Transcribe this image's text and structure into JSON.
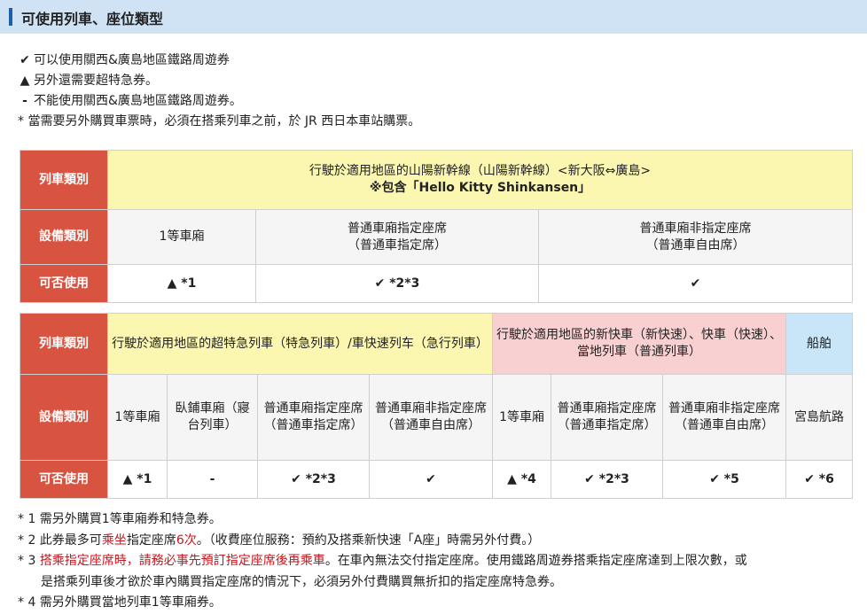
{
  "title": "可使用列車、座位類型",
  "legend": [
    {
      "symbol": "✔",
      "text": "可以使用關西&廣島地區鐵路周遊券"
    },
    {
      "symbol": "▲",
      "text": "另外還需要超特急券。"
    },
    {
      "symbol": "-",
      "text": "不能使用關西&廣島地區鐵路周遊券。"
    }
  ],
  "legend_note": "* 當需要另外購買車票時，必須在搭乘列車之前，於 JR 西日本車站購票。",
  "table1": {
    "row_train": "列車類別",
    "row_facility": "設備類別",
    "row_usable": "可否使用",
    "train_line1": "行駛於適用地區的山陽新幹線（山陽新幹線）<新大阪⇔廣島>",
    "train_line2": "※包含「Hello Kitty Shinkansen」",
    "facilities": [
      "1等車廂",
      "普通車廂指定座席\n（普通車指定席）",
      "普通車廂非指定座席\n（普通車自由席）"
    ],
    "usable": [
      "▲ *1",
      "✔ *2*3",
      "✔"
    ]
  },
  "table2": {
    "row_train": "列車類別",
    "row_facility": "設備類別",
    "row_usable": "可否使用",
    "train_a": "行駛於適用地區的超特急列車（特急列車）/車快速列车（急行列車）",
    "train_b": "行駛於適用地區的新快車（新快速）、快車（快速）、當地列車（普通列車）",
    "train_c": "船舶",
    "facilities": [
      "1等車廂",
      "臥鋪車廂（寢台列車）",
      "普通車廂指定座席（普通車指定席）",
      "普通車廂非指定座席（普通車自由席）",
      "1等車廂",
      "普通車廂指定座席（普通車指定席）",
      "普通車廂非指定座席（普通車自由席）",
      "宮島航路"
    ],
    "usable": [
      "▲ *1",
      "-",
      "✔ *2*3",
      "✔",
      "▲ *4",
      "✔ *2*3",
      "✔ *5",
      "✔ *6"
    ]
  },
  "notes": {
    "n1": "* 1 需另外購買1等車廂券和特急券。",
    "n2_pre": "* 2 此券最多可",
    "n2_red": "乘坐",
    "n2_mid": "指定座席",
    "n2_red2": "6次",
    "n2_post": "。（收費座位服務：預約及搭乘新快速「A座」時需另外付費。）",
    "n3_pre": "* 3 ",
    "n3_red": "搭乘指定座席時，請務必事先預訂指定座席後再乘車",
    "n3_post": "。在車內無法交付指定座席。使用鐵路周遊券搭乘指定座席達到上限次數，或",
    "n3_cont": "是搭乘列車後才欲於車內購買指定座席的情況下，必須另外付費購買無折扣的指定座席特急券。",
    "n4": "* 4 需另外購買當地列車1等車廂券。"
  }
}
